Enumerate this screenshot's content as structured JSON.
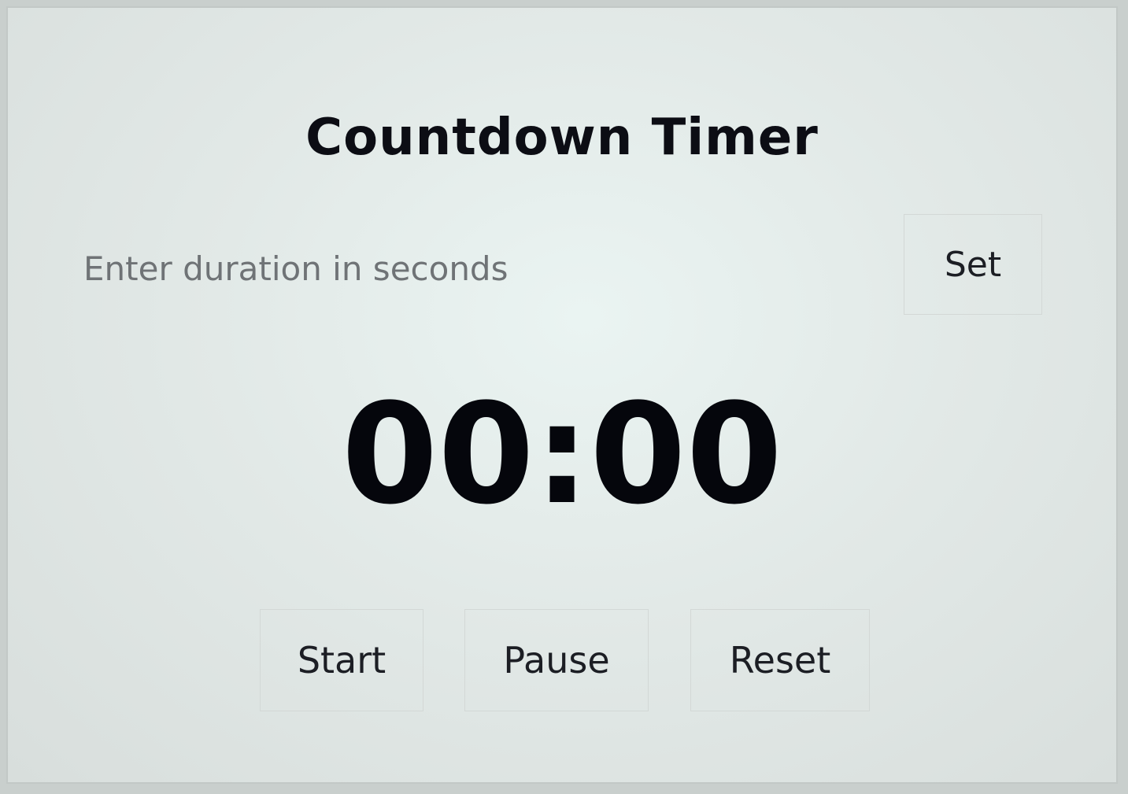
{
  "app": {
    "title": "Countdown Timer"
  },
  "duration": {
    "value": "",
    "placeholder": "Enter duration in seconds",
    "set_label": "Set"
  },
  "timer": {
    "display": "00:00"
  },
  "controls": {
    "start_label": "Start",
    "pause_label": "Pause",
    "reset_label": "Reset"
  },
  "colors": {
    "text": "#0c0d14",
    "placeholder": "#6f7376",
    "background": "#e2e9e7"
  }
}
